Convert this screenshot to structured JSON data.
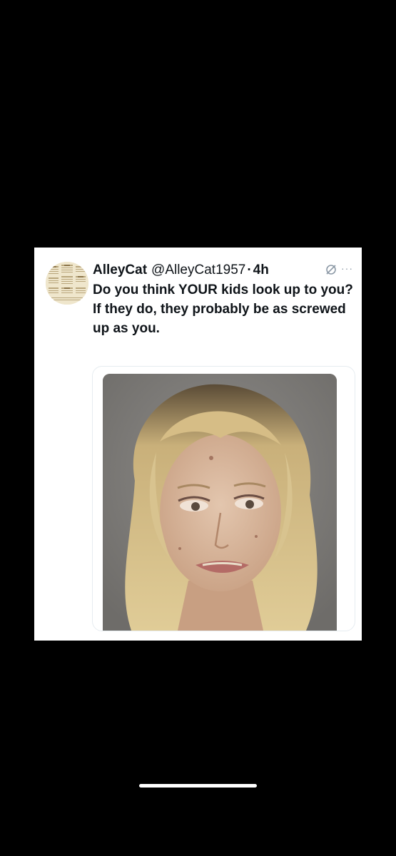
{
  "tweet": {
    "display_name": "AlleyCat",
    "handle": "@AlleyCat1957",
    "separator": "·",
    "timestamp": "4h",
    "text_lines": [
      "Do you think YOUR kids look up to you?",
      "If they do, they probably be as screwed up as you."
    ],
    "more_label": "···",
    "avatar_icon": "newspaper-collage-avatar",
    "media_icon": "mugshot-photo"
  },
  "colors": {
    "background": "#000000",
    "card": "#ffffff",
    "text": "#0f1419",
    "muted": "#8b98a5"
  }
}
